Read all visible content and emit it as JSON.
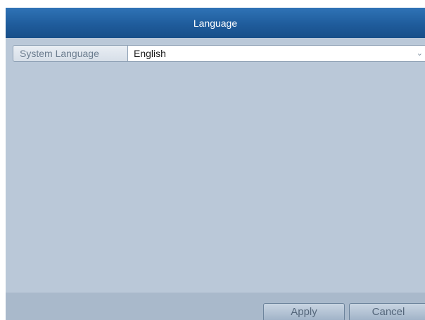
{
  "dialog": {
    "title": "Language",
    "system_language": {
      "label": "System Language",
      "selected": "English"
    },
    "buttons": {
      "apply": "Apply",
      "cancel": "Cancel"
    }
  },
  "colors": {
    "titlebar": "#1f5c9c",
    "content_bg": "#bac8d8",
    "footer_bg": "#a9b9cb"
  },
  "icons": {
    "dropdown": "chevron-down-icon"
  }
}
